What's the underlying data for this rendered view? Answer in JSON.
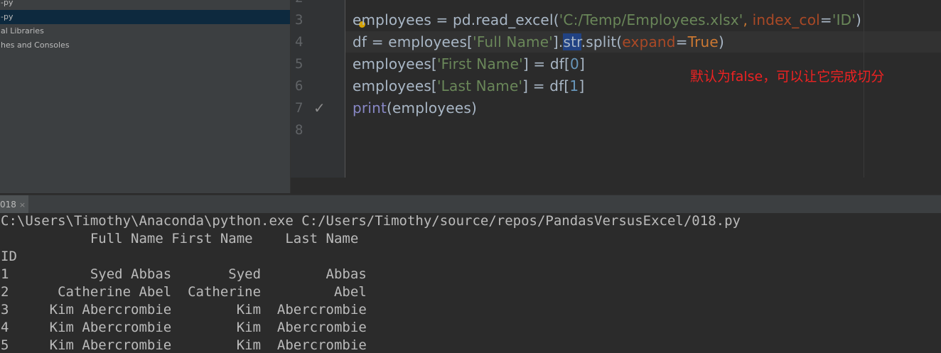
{
  "project": {
    "items": [
      {
        "label": "-py",
        "selected": false
      },
      {
        "label": "-py",
        "selected": true
      },
      {
        "label": "al Libraries",
        "selected": false
      },
      {
        "label": "hes and Consoles",
        "selected": false
      }
    ]
  },
  "editor": {
    "line_numbers": [
      "2",
      "3",
      "4",
      "5",
      "6",
      "7",
      "8"
    ],
    "code": {
      "l3_a": "employees = pd.read_excel(",
      "l3_path": "'C:/Temp/Employees.xlsx'",
      "l3_b": ", ",
      "l3_param": "index_col",
      "l3_eq": "=",
      "l3_id": "'ID'",
      "l3_c": ")",
      "l4_a": "df = employees[",
      "l4_full": "'Full Name'",
      "l4_b": "].",
      "l4_str": "str",
      "l4_c": ".split(",
      "l4_param": "expand",
      "l4_eq": "=",
      "l4_true": "True",
      "l4_d": ")",
      "l5_a": "employees[",
      "l5_first": "'First Name'",
      "l5_b": "] = df[",
      "l5_num": "0",
      "l5_c": "]",
      "l6_a": "employees[",
      "l6_last": "'Last Name'",
      "l6_b": "] = df[",
      "l6_num": "1",
      "l6_c": "]",
      "l7_print": "print",
      "l7_a": "(employees)"
    },
    "annotation": "默认为false，可以让它完成切分"
  },
  "run": {
    "tab_label": "018",
    "tab_close": "×",
    "console_lines": [
      "C:\\Users\\Timothy\\Anaconda\\python.exe C:/Users/Timothy/source/repos/PandasVersusExcel/018.py",
      "           Full Name First Name    Last Name",
      "ID",
      "1          Syed Abbas       Syed        Abbas",
      "2      Catherine Abel  Catherine         Abel",
      "3     Kim Abercrombie        Kim  Abercrombie",
      "4     Kim Abercrombie        Kim  Abercrombie",
      "5     Kim Abercrombie        Kim  Abercrombie"
    ]
  },
  "colors": {
    "background": "#2b2b2b",
    "string": "#6a8759",
    "keyword": "#cc7832",
    "annotation": "#ee2222"
  }
}
